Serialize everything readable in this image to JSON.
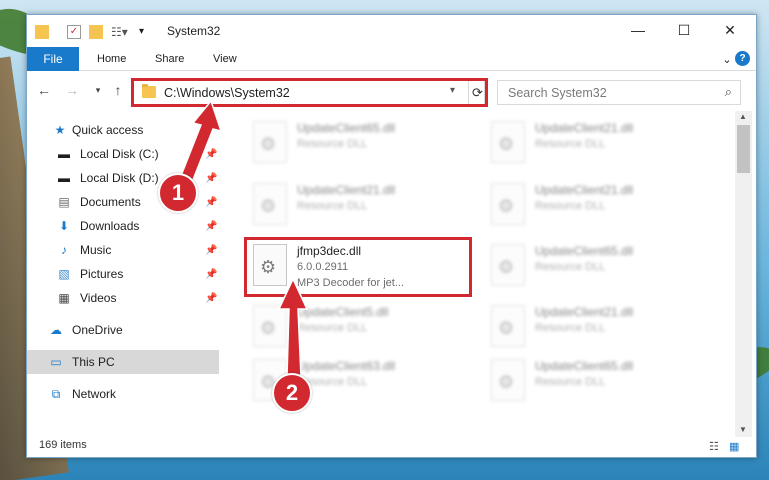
{
  "window": {
    "title": "System32"
  },
  "ribbon": {
    "file": "File",
    "tabs": [
      "Home",
      "Share",
      "View"
    ]
  },
  "address": {
    "path": "C:\\Windows\\System32"
  },
  "search": {
    "placeholder": "Search System32"
  },
  "nav": {
    "items": [
      {
        "label": "Quick access",
        "icon": "star-icon"
      },
      {
        "label": "Local Disk (C:)",
        "icon": "disk-icon"
      },
      {
        "label": "Local Disk (D:)",
        "icon": "disk-icon"
      },
      {
        "label": "Documents",
        "icon": "documents-icon"
      },
      {
        "label": "Downloads",
        "icon": "download-icon"
      },
      {
        "label": "Music",
        "icon": "music-icon"
      },
      {
        "label": "Pictures",
        "icon": "pictures-icon"
      },
      {
        "label": "Videos",
        "icon": "videos-icon"
      },
      {
        "label": "OneDrive",
        "icon": "cloud-icon"
      },
      {
        "label": "This PC",
        "icon": "pc-icon"
      },
      {
        "label": "Network",
        "icon": "network-icon"
      }
    ]
  },
  "files": [
    {
      "name": "UpdateClient65.dll",
      "sub": "Resource DLL"
    },
    {
      "name": "UpdateClient21.dll",
      "sub": "Resource DLL"
    },
    {
      "name": "UpdateClient21.dll",
      "sub": "Resource DLL"
    },
    {
      "name": "UpdateClient21.dll",
      "sub": "Resource DLL"
    },
    {
      "name": "jfmp3dec.dll",
      "sub": "6.0.0.2911",
      "sub2": "MP3 Decoder for jet..."
    },
    {
      "name": "UpdateClient65.dll",
      "sub": "Resource DLL"
    },
    {
      "name": "UpdateClient5.dll",
      "sub": "Resource DLL"
    },
    {
      "name": "UpdateClient21.dll",
      "sub": "Resource DLL"
    },
    {
      "name": "UpdateClient63.dll",
      "sub": "Resource DLL"
    },
    {
      "name": "UpdateClient65.dll",
      "sub": "Resource DLL"
    }
  ],
  "status": {
    "count": "169 items"
  },
  "callouts": {
    "one": "1",
    "two": "2"
  },
  "colors": {
    "accent": "#1979ca",
    "highlight": "#d2282f"
  }
}
